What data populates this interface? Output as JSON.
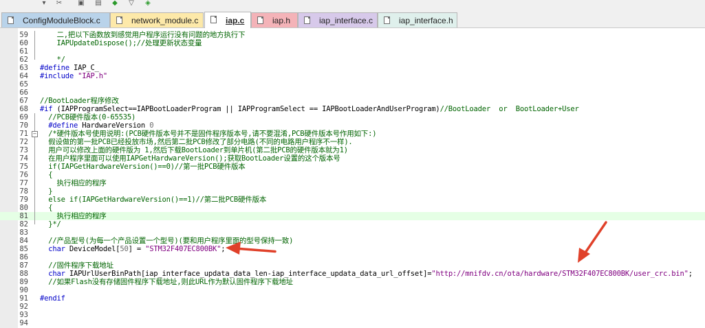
{
  "toolbar": {
    "icons": [
      "dropdown-icon",
      "wrench-icon",
      "window-icon",
      "window-icon",
      "diamond-download-icon",
      "filter-icon",
      "component-icon"
    ]
  },
  "tabs": [
    {
      "label": "ConfigModuleBlock.c",
      "color": "#b9d3ea",
      "active": false
    },
    {
      "label": "network_module.c",
      "color": "#fde9a9",
      "active": false
    },
    {
      "label": "iap.c",
      "color": "#d9efd2",
      "active": true
    },
    {
      "label": "iap.h",
      "color": "#f4b3b8",
      "active": false
    },
    {
      "label": "iap_interface.c",
      "color": "#d7c9ea",
      "active": false
    },
    {
      "label": "iap_interface.h",
      "color": "#dff0ec",
      "active": false
    }
  ],
  "lines": [
    {
      "n": "59",
      "segs": [
        {
          "t": "    二,把以下函数放到感觉用户程序运行没有问题的地方执行下",
          "c": "comment"
        }
      ]
    },
    {
      "n": "60",
      "segs": [
        {
          "t": "    IAPUpdateDispose();//处理更新状态变量",
          "c": "comment"
        }
      ]
    },
    {
      "n": "61",
      "segs": []
    },
    {
      "n": "62",
      "segs": [
        {
          "t": "    */",
          "c": "comment"
        }
      ]
    },
    {
      "n": "63",
      "segs": [
        {
          "t": "#define",
          "c": "pre"
        },
        {
          "t": " IAP_C_",
          "c": ""
        }
      ]
    },
    {
      "n": "64",
      "segs": [
        {
          "t": "#include",
          "c": "pre"
        },
        {
          "t": " \"IAP.h\"",
          "c": "str"
        }
      ]
    },
    {
      "n": "65",
      "segs": []
    },
    {
      "n": "66",
      "segs": []
    },
    {
      "n": "67",
      "segs": [
        {
          "t": "//BootLoader程序修改",
          "c": "comment"
        }
      ]
    },
    {
      "n": "68",
      "segs": [
        {
          "t": "#if",
          "c": "pre"
        },
        {
          "t": " (IAPProgramSelect==IAPBootLoaderProgram || IAPProgramSelect == IAPBootLoaderAndUserProgram)",
          "c": ""
        },
        {
          "t": "//BootLoader  or  BootLoader+User",
          "c": "comment"
        }
      ]
    },
    {
      "n": "69",
      "segs": [
        {
          "t": "  //PCB硬件版本(0-65535)",
          "c": "comment"
        }
      ]
    },
    {
      "n": "70",
      "segs": [
        {
          "t": "  ",
          "c": ""
        },
        {
          "t": "#define",
          "c": "pre"
        },
        {
          "t": " HardwareVersion ",
          "c": ""
        },
        {
          "t": "0",
          "c": "num"
        }
      ]
    },
    {
      "n": "71",
      "segs": [
        {
          "t": "  /*硬件版本号使用说明:(PCB硬件版本号并不是固件程序版本号,请不要混淆,PCB硬件版本号作用如下:)",
          "c": "comment"
        }
      ]
    },
    {
      "n": "72",
      "segs": [
        {
          "t": "  假设做的第一批PCB已经投放市场,然后第二批PCB修改了部分电路(不同的电路用户程序不一样).",
          "c": "comment"
        }
      ]
    },
    {
      "n": "73",
      "segs": [
        {
          "t": "  用户可以修改上面的硬件版为 1,然后下载BootLoader到单片机(第二批PCB的硬件版本就为1)",
          "c": "comment"
        }
      ]
    },
    {
      "n": "74",
      "segs": [
        {
          "t": "  在用户程序里面可以使用IAPGetHardwareVersion();获取BootLoader设置的这个版本号",
          "c": "comment"
        }
      ]
    },
    {
      "n": "75",
      "segs": [
        {
          "t": "  if(IAPGetHardwareVersion()==0)//第一批PCB硬件版本",
          "c": "comment"
        }
      ]
    },
    {
      "n": "76",
      "segs": [
        {
          "t": "  {",
          "c": "comment"
        }
      ]
    },
    {
      "n": "77",
      "segs": [
        {
          "t": "    执行相应的程序",
          "c": "comment"
        }
      ]
    },
    {
      "n": "78",
      "segs": [
        {
          "t": "  }",
          "c": "comment"
        }
      ]
    },
    {
      "n": "79",
      "segs": [
        {
          "t": "  else if(IAPGetHardwareVersion()==1)//第二批PCB硬件版本",
          "c": "comment"
        }
      ]
    },
    {
      "n": "80",
      "segs": [
        {
          "t": "  {",
          "c": "comment"
        }
      ]
    },
    {
      "n": "81",
      "segs": [
        {
          "t": "    执行相应的程序",
          "c": "comment"
        }
      ],
      "hl": true
    },
    {
      "n": "82",
      "segs": [
        {
          "t": "  }*/",
          "c": "comment"
        }
      ]
    },
    {
      "n": "83",
      "segs": []
    },
    {
      "n": "84",
      "segs": [
        {
          "t": "  //产品型号(为每一个产品设置一个型号)(要和用户程序里面的型号保持一致)",
          "c": "comment"
        }
      ]
    },
    {
      "n": "85",
      "segs": [
        {
          "t": "  ",
          "c": ""
        },
        {
          "t": "char",
          "c": "kw"
        },
        {
          "t": " DeviceModel[",
          "c": ""
        },
        {
          "t": "50",
          "c": "num"
        },
        {
          "t": "] = ",
          "c": ""
        },
        {
          "t": "\"STM32F407EC800BK\"",
          "c": "str"
        },
        {
          "t": ";",
          "c": ""
        }
      ]
    },
    {
      "n": "86",
      "segs": []
    },
    {
      "n": "87",
      "segs": [
        {
          "t": "  //固件程序下载地址",
          "c": "comment"
        }
      ]
    },
    {
      "n": "88",
      "segs": [
        {
          "t": "  ",
          "c": ""
        },
        {
          "t": "char",
          "c": "kw"
        },
        {
          "t": " IAPUrlUserBinPath[iap_interface_updata_data_len-iap_interface_updata_data_url_offset]=",
          "c": ""
        },
        {
          "t": "\"http://mnifdv.cn/ota/hardware/STM32F407EC800BK/user_crc.bin\"",
          "c": "str"
        },
        {
          "t": ";",
          "c": ""
        }
      ]
    },
    {
      "n": "89",
      "segs": [
        {
          "t": "  //如果Flash没有存储固件程序下载地址,则此URL作为默认固件程序下载地址",
          "c": "comment"
        }
      ]
    },
    {
      "n": "90",
      "segs": []
    },
    {
      "n": "91",
      "segs": [
        {
          "t": "#endif",
          "c": "pre"
        }
      ]
    },
    {
      "n": "92",
      "segs": []
    },
    {
      "n": "93",
      "segs": []
    },
    {
      "n": "94",
      "segs": []
    }
  ],
  "annotations": {
    "arrow_color": "#e0412a"
  }
}
